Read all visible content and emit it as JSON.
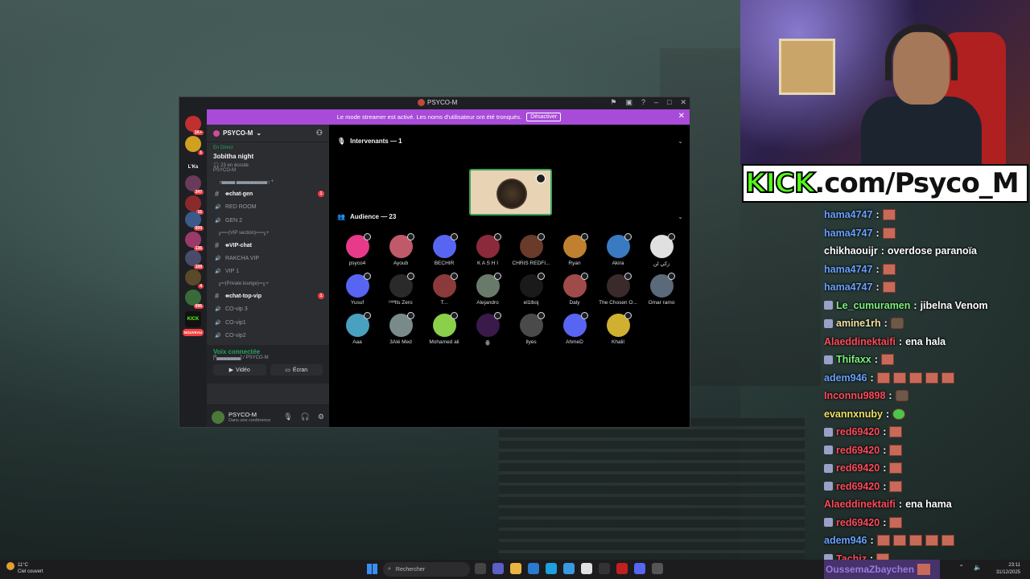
{
  "discord": {
    "window_title": "PSYCO-M",
    "streamer_banner": {
      "text": "Le mode streamer est activé. Les noms d'utilisateur ont été tronqués.",
      "button": "Désactiver"
    },
    "guild_badges": [
      "1K+",
      "1",
      "L'Ks",
      "347",
      "15",
      "609",
      "136",
      "108",
      "4",
      "696",
      "KICK",
      "NOUVEAU"
    ],
    "server_name": "PSYCO-M",
    "event": {
      "status": "En Direct",
      "name": "3obitha night",
      "meta": "23 en écoute",
      "host": "PSYCO-M"
    },
    "channels": [
      {
        "kind": "category",
        "label": "┌▄▄▄▄ ▄▄▄▄▄▄▄▄▄┐"
      },
      {
        "kind": "text",
        "label": "ᚑchat-gen",
        "unread": "1"
      },
      {
        "kind": "voice",
        "label": "RED ROOM"
      },
      {
        "kind": "voice",
        "label": "GEN 2"
      },
      {
        "kind": "category",
        "label": "╔══(VIP section)══╗"
      },
      {
        "kind": "text",
        "label": "ᚑVIP-chat"
      },
      {
        "kind": "voice",
        "label": "RAKCHA VIP"
      },
      {
        "kind": "voice",
        "label": "VIP 1"
      },
      {
        "kind": "category",
        "label": "╔═(Private lounge)═╗"
      },
      {
        "kind": "text",
        "label": "ᚑchat-top-vip",
        "unread": "1"
      },
      {
        "kind": "voice",
        "label": "CO-vip 3"
      },
      {
        "kind": "voice",
        "label": "CO-vip1"
      },
      {
        "kind": "voice",
        "label": "CO-vip2"
      }
    ],
    "voice_panel": {
      "status": "Voix connectée",
      "location": "[ᴯ▄▄▄▄▄▄▄] / PSYCO-M",
      "video_label": "Vidéo",
      "screen_label": "Écran"
    },
    "user_panel": {
      "name": "PSYCO-M",
      "status": "Dans une conférence"
    },
    "stage": {
      "speakers_header": "Intervenants — 1",
      "audience_header": "Audience — 23",
      "audience": [
        {
          "name": "psyco4",
          "color": "#e83a8a"
        },
        {
          "name": "Ayoub",
          "color": "#c05a6a"
        },
        {
          "name": "BECHIR",
          "color": "#5865f2"
        },
        {
          "name": "K A S H I",
          "color": "#8a2a3a"
        },
        {
          "name": "CHRIS REDFI...",
          "color": "#6a3a2a"
        },
        {
          "name": "Ryan",
          "color": "#c08030"
        },
        {
          "name": "Akira",
          "color": "#3a7ac0"
        },
        {
          "name": "زكي لن",
          "color": "#e0e0e0"
        },
        {
          "name": "Yusuf",
          "color": "#5865f2"
        },
        {
          "name": "ᴵᴬᴹIts Zero",
          "color": "#2a2a2a"
        },
        {
          "name": "T...",
          "color": "#8a3a3a"
        },
        {
          "name": "Alejandro",
          "color": "#6a7a6a"
        },
        {
          "name": "el1lboj",
          "color": "#1a1a1a"
        },
        {
          "name": "Daly",
          "color": "#a04a4a"
        },
        {
          "name": "The Chosen O...",
          "color": "#3a2a2a"
        },
        {
          "name": "Omar ramo",
          "color": "#5a6a7a"
        },
        {
          "name": "Aaa",
          "color": "#4aa0c0"
        },
        {
          "name": "3Alé Med",
          "color": "#7a8a8a"
        },
        {
          "name": "Mohamed ali",
          "color": "#8ad04a"
        },
        {
          "name": "ꙮ",
          "color": "#3a1a4a"
        },
        {
          "name": "Ilyes",
          "color": "#4a4a4a"
        },
        {
          "name": "AhmeD",
          "color": "#5865f2"
        },
        {
          "name": "Khalil",
          "color": "#d0b030"
        }
      ]
    }
  },
  "kick_banner": {
    "prefix": "KICK",
    "rest": ".com/Psyco_M"
  },
  "chat": [
    {
      "user": "hama4747",
      "color": "#6aa0ff",
      "text": "",
      "emotes": [
        "box"
      ]
    },
    {
      "user": "hama4747",
      "color": "#6aa0ff",
      "text": "",
      "emotes": [
        "box"
      ]
    },
    {
      "user": "chikhaouijr",
      "color": "#ffffff",
      "text": "overdose paranoïa",
      "emotes": []
    },
    {
      "user": "hama4747",
      "color": "#6aa0ff",
      "text": "",
      "emotes": [
        "box"
      ]
    },
    {
      "user": "hama4747",
      "color": "#6aa0ff",
      "text": "",
      "emotes": [
        "box"
      ]
    },
    {
      "user": "Le_cumuramen",
      "color": "#7af07a",
      "text": "jibelna Venom",
      "emotes": [],
      "badge": true
    },
    {
      "user": "amine1rh",
      "color": "#f0e0a0",
      "text": "",
      "emotes": [
        "face"
      ],
      "badge": true
    },
    {
      "user": "Alaeddinektaifi",
      "color": "#ff4a5a",
      "text": "ena hala",
      "emotes": []
    },
    {
      "user": "Thifaxx",
      "color": "#7af07a",
      "text": "",
      "emotes": [
        "box"
      ],
      "badge": true
    },
    {
      "user": "adem946",
      "color": "#6aa0ff",
      "text": "",
      "emotes": [
        "box",
        "box",
        "box",
        "box",
        "box"
      ]
    },
    {
      "user": "Inconnu9898",
      "color": "#ff4a5a",
      "text": "",
      "emotes": [
        "face"
      ]
    },
    {
      "user": "evannxnuby",
      "color": "#f0e060",
      "text": "",
      "emotes": [
        "green"
      ]
    },
    {
      "user": "red69420",
      "color": "#ff4a5a",
      "text": "",
      "emotes": [
        "box"
      ],
      "badge": true
    },
    {
      "user": "red69420",
      "color": "#ff4a5a",
      "text": "",
      "emotes": [
        "box"
      ],
      "badge": true
    },
    {
      "user": "red69420",
      "color": "#ff4a5a",
      "text": "",
      "emotes": [
        "box"
      ],
      "badge": true
    },
    {
      "user": "red69420",
      "color": "#ff4a5a",
      "text": "",
      "emotes": [
        "box"
      ],
      "badge": true
    },
    {
      "user": "Alaeddinektaifi",
      "color": "#ff4a5a",
      "text": "ena hama",
      "emotes": []
    },
    {
      "user": "red69420",
      "color": "#ff4a5a",
      "text": "",
      "emotes": [
        "box"
      ],
      "badge": true
    },
    {
      "user": "adem946",
      "color": "#6aa0ff",
      "text": "",
      "emotes": [
        "box",
        "box",
        "box",
        "box",
        "box"
      ]
    },
    {
      "user": "Tachiz",
      "color": "#ff4a5a",
      "text": "",
      "emotes": [
        "box"
      ],
      "badge": true
    }
  ],
  "taskbar": {
    "weather_temp": "11°C",
    "weather_desc": "Ciel couvert",
    "search_placeholder": "Rechercher",
    "kick_user": "OussemaZbaychen",
    "time": "23:11",
    "date": "31/12/2025"
  }
}
